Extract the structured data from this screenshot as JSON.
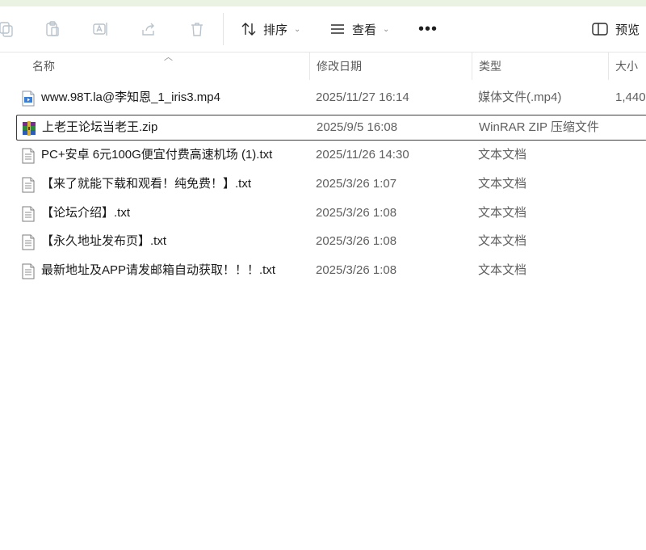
{
  "toolbar": {
    "sort_label": "排序",
    "view_label": "查看",
    "more_label": "•••",
    "preview_label": "预览"
  },
  "columns": {
    "name": "名称",
    "date": "修改日期",
    "type": "类型",
    "size": "大小"
  },
  "files": [
    {
      "name": "www.98T.la@李知恩_1_iris3.mp4",
      "date": "2025/11/27 16:14",
      "type": "媒体文件(.mp4)",
      "size": "1,440",
      "icon": "video-file-icon"
    },
    {
      "name": "上老王论坛当老王.zip",
      "date": "2025/9/5 16:08",
      "type": "WinRAR ZIP 压缩文件",
      "size": "",
      "icon": "winrar-archive-icon"
    },
    {
      "name": "PC+安卓 6元100G便宜付费高速机场 (1).txt",
      "date": "2025/11/26 14:30",
      "type": "文本文档",
      "size": "",
      "icon": "text-file-icon"
    },
    {
      "name": "【来了就能下载和观看！纯免费！】.txt",
      "date": "2025/3/26 1:07",
      "type": "文本文档",
      "size": "",
      "icon": "text-file-icon"
    },
    {
      "name": "【论坛介绍】.txt",
      "date": "2025/3/26 1:08",
      "type": "文本文档",
      "size": "",
      "icon": "text-file-icon"
    },
    {
      "name": "【永久地址发布页】.txt",
      "date": "2025/3/26 1:08",
      "type": "文本文档",
      "size": "",
      "icon": "text-file-icon"
    },
    {
      "name": "最新地址及APP请发邮箱自动获取！！！.txt",
      "date": "2025/3/26 1:08",
      "type": "文本文档",
      "size": "",
      "icon": "text-file-icon"
    }
  ]
}
